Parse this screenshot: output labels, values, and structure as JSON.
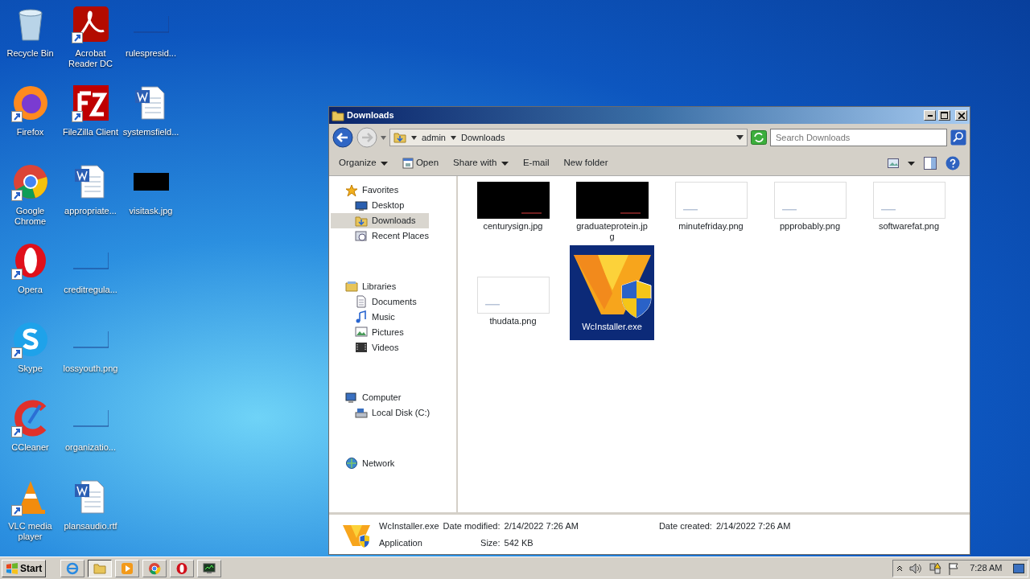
{
  "desktop": {
    "columns": [
      [
        {
          "label": "Recycle Bin",
          "kind": "recycle",
          "shortcut": false
        },
        {
          "label": "Firefox",
          "kind": "firefox",
          "shortcut": true
        },
        {
          "label": "Google Chrome",
          "kind": "chrome",
          "shortcut": true
        },
        {
          "label": "Opera",
          "kind": "opera",
          "shortcut": true
        },
        {
          "label": "Skype",
          "kind": "skype",
          "shortcut": true
        },
        {
          "label": "CCleaner",
          "kind": "ccleaner",
          "shortcut": true
        },
        {
          "label": "VLC media player",
          "kind": "vlc",
          "shortcut": true
        }
      ],
      [
        {
          "label": "Acrobat Reader DC",
          "kind": "acrobat",
          "shortcut": true
        },
        {
          "label": "FileZilla Client",
          "kind": "filezilla",
          "shortcut": true
        },
        {
          "label": "appropriate...",
          "kind": "word",
          "shortcut": false
        },
        {
          "label": "creditregula...",
          "kind": "blank",
          "shortcut": false
        },
        {
          "label": "lossyouth.png",
          "kind": "blank",
          "shortcut": false
        },
        {
          "label": "organizatio...",
          "kind": "blank",
          "shortcut": false
        },
        {
          "label": "plansaudio.rtf",
          "kind": "word",
          "shortcut": false
        }
      ],
      [
        {
          "label": "rulespresid...",
          "kind": "blank",
          "shortcut": false
        },
        {
          "label": "systemsfield...",
          "kind": "word",
          "shortcut": false
        },
        {
          "label": "visitask.jpg",
          "kind": "black",
          "shortcut": false
        }
      ]
    ]
  },
  "window": {
    "title": "Downloads",
    "breadcrumb": [
      "admin",
      "Downloads"
    ],
    "search": {
      "placeholder": "Search Downloads"
    },
    "toolbar": [
      {
        "label": "Organize",
        "kind": "menu"
      },
      {
        "label": "Open",
        "kind": "icon"
      },
      {
        "label": "Share with",
        "kind": "menu"
      },
      {
        "label": "E-mail",
        "kind": "plain"
      },
      {
        "label": "New folder",
        "kind": "plain"
      }
    ],
    "nav": [
      {
        "label": "Favorites",
        "kind": "star",
        "selected": false,
        "children": [
          {
            "label": "Desktop",
            "kind": "desktop",
            "selected": false
          },
          {
            "label": "Downloads",
            "kind": "download",
            "selected": true
          },
          {
            "label": "Recent Places",
            "kind": "recent",
            "selected": false
          }
        ]
      },
      {
        "label": "Libraries",
        "kind": "library",
        "selected": false,
        "children": [
          {
            "label": "Documents",
            "kind": "document",
            "selected": false
          },
          {
            "label": "Music",
            "kind": "music",
            "selected": false
          },
          {
            "label": "Pictures",
            "kind": "pictures",
            "selected": false
          },
          {
            "label": "Videos",
            "kind": "videos",
            "selected": false
          }
        ]
      },
      {
        "label": "Computer",
        "kind": "computer",
        "selected": false,
        "children": [
          {
            "label": "Local Disk (C:)",
            "kind": "disk",
            "selected": false
          }
        ]
      },
      {
        "label": "Network",
        "kind": "network",
        "selected": false
      }
    ],
    "files": [
      {
        "name": "centurysign.jpg",
        "kind": "dark",
        "selected": false
      },
      {
        "name": "graduateprotein.jpg",
        "kind": "dark",
        "selected": false
      },
      {
        "name": "minutefriday.png",
        "kind": "light",
        "selected": false
      },
      {
        "name": "ppprobably.png",
        "kind": "light",
        "selected": false
      },
      {
        "name": "softwarefat.png",
        "kind": "light",
        "selected": false
      },
      {
        "name": "thudata.png",
        "kind": "light",
        "selected": false
      },
      {
        "name": "WcInstaller.exe",
        "kind": "app",
        "selected": true
      }
    ],
    "details": {
      "name": "WcInstaller.exe",
      "type": "Application",
      "fields": [
        {
          "label": "Date modified:",
          "value": "2/14/2022 7:26 AM"
        },
        {
          "label": "Date created:",
          "value": "2/14/2022 7:26 AM"
        },
        {
          "label": "Size:",
          "value": "542 KB"
        }
      ]
    }
  },
  "taskbar": {
    "start": "Start",
    "apps": [
      {
        "kind": "ie",
        "active": false
      },
      {
        "kind": "explorer",
        "active": true
      },
      {
        "kind": "media",
        "active": false
      },
      {
        "kind": "chrome",
        "active": false
      },
      {
        "kind": "opera",
        "active": false
      },
      {
        "kind": "monitor",
        "active": false
      }
    ],
    "clock": "7:28 AM"
  }
}
